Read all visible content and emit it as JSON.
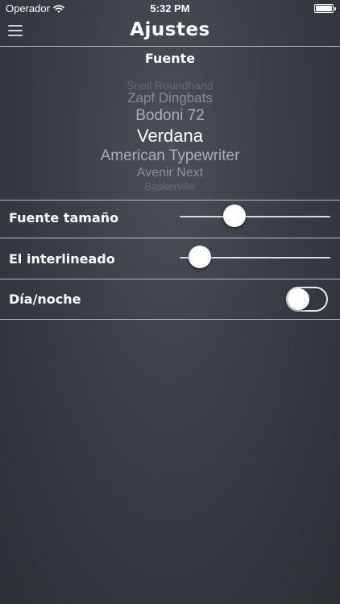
{
  "status_bar": {
    "carrier": "Operador",
    "time": "5:32 PM"
  },
  "nav": {
    "title": "Ajustes"
  },
  "font_section": {
    "title": "Fuente",
    "options": [
      "Snell Roundhand",
      "Zapf Dingbats",
      "Bodoni 72",
      "Verdana",
      "American Typewriter",
      "Avenir Next",
      "Baskerville"
    ],
    "selected": "Verdana"
  },
  "settings": {
    "font_size": {
      "label": "Fuente tamaño",
      "value": 0.34
    },
    "line_spacing": {
      "label": "El interlineado",
      "value": 0.07
    },
    "day_night": {
      "label": "Día/noche",
      "on": false
    }
  },
  "colors": {
    "background_top": "#4c5056",
    "background_bottom": "#2b2e33",
    "divider": "#b9bcc0",
    "text": "#ffffff"
  },
  "icons": {
    "menu": "hamburger-menu-icon",
    "wifi": "wifi-icon",
    "battery": "battery-icon"
  }
}
